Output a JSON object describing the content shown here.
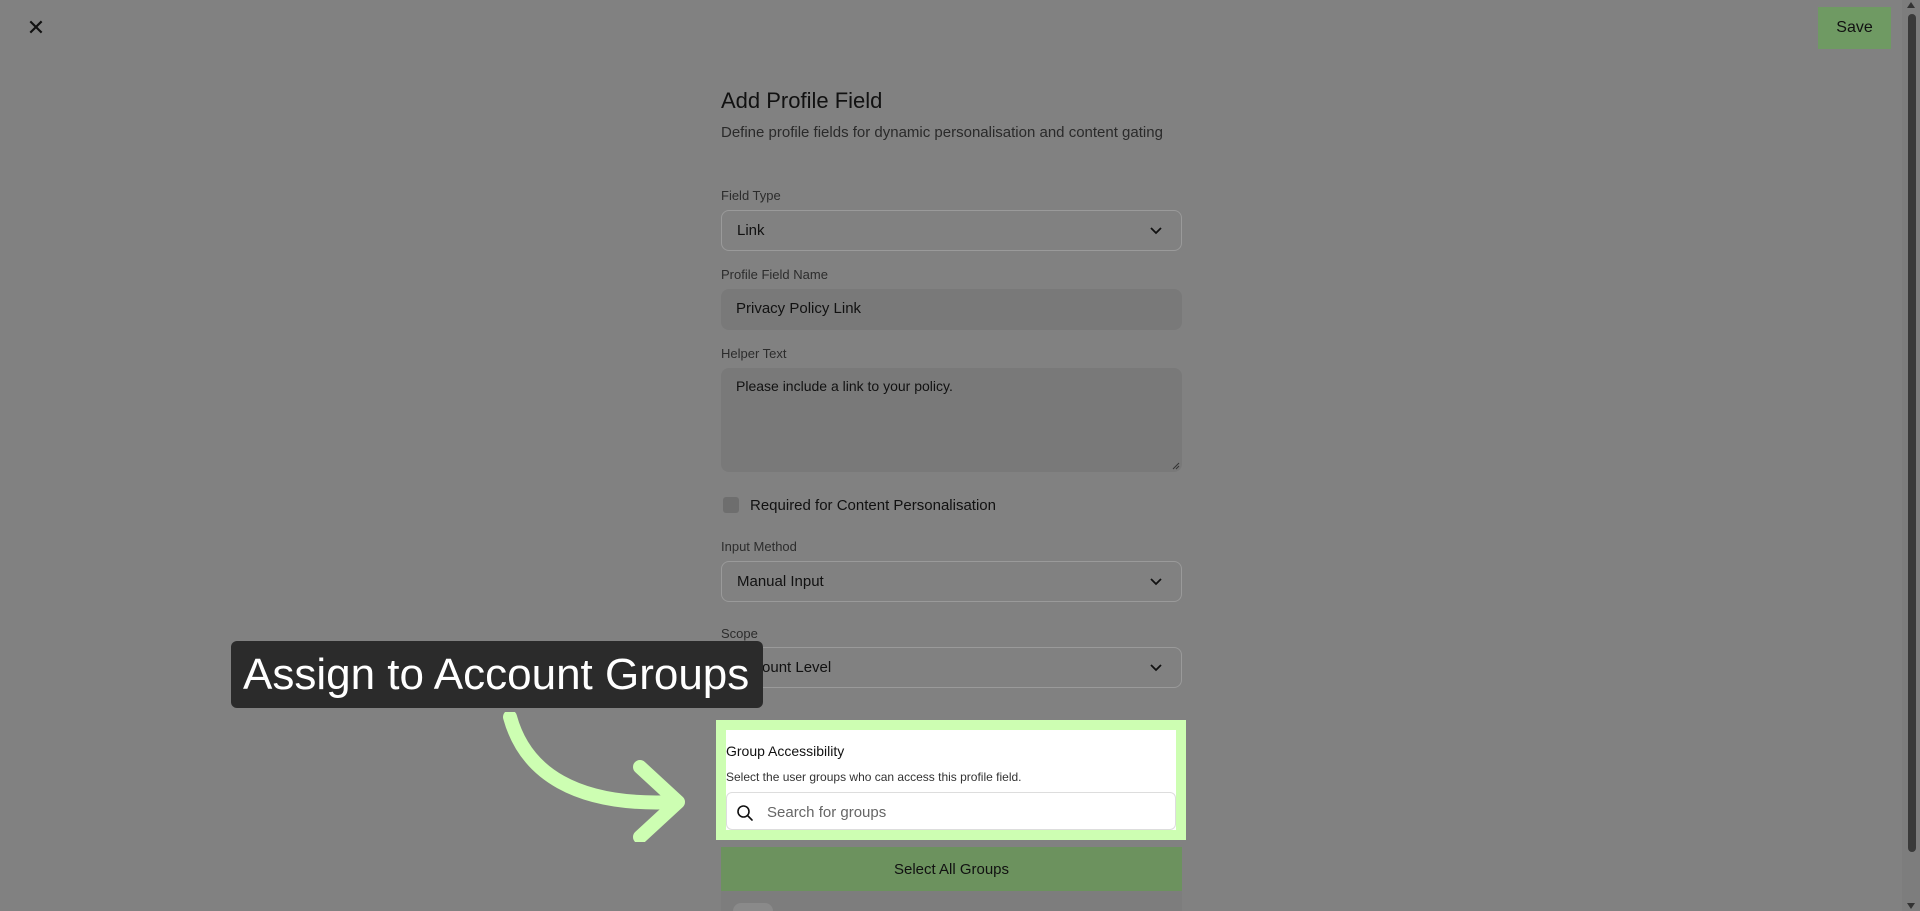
{
  "header": {
    "close_glyph": "✕",
    "save_label": "Save"
  },
  "form": {
    "title": "Add Profile Field",
    "subtitle": "Define profile fields for dynamic personalisation and content gating",
    "field_type": {
      "label": "Field Type",
      "value": "Link"
    },
    "profile_field_name": {
      "label": "Profile Field Name",
      "value": "Privacy Policy Link"
    },
    "helper_text": {
      "label": "Helper Text",
      "value": "Please include a link to your policy."
    },
    "required_checkbox": {
      "label": "Required for Content Personalisation",
      "checked": false
    },
    "input_method": {
      "label": "Input Method",
      "value": "Manual Input"
    },
    "scope": {
      "label": "Scope",
      "value": "Account Level"
    },
    "group_accessibility": {
      "title": "Group Accessibility",
      "subtitle": "Select the user groups who can access this profile field.",
      "search_placeholder": "Search for groups"
    },
    "select_all_label": "Select All Groups"
  },
  "annotation": {
    "tooltip_text": "Assign to Account Groups"
  },
  "colors": {
    "overlay": "#818181",
    "accent_green": "#6f9a63",
    "highlight_border": "#cdfeb2",
    "tooltip_bg": "#2b2b2b"
  }
}
